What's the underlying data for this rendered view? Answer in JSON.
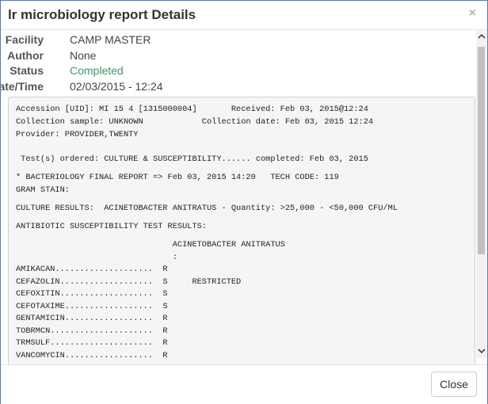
{
  "dialog": {
    "title": "lr microbiology report Details",
    "close_glyph": "×",
    "close_button_label": "Close"
  },
  "meta": {
    "facility_label": "Facility",
    "facility_value": "CAMP MASTER",
    "author_label": "Author",
    "author_value": "None",
    "status_label": "Status",
    "status_value": "Completed",
    "datetime_label": "Date/Time",
    "datetime_value": "02/03/2015 - 12:24"
  },
  "report": {
    "lines": [
      "Accession [UID]: MI 15 4 [1315000004]       Received: Feb 03, 2015@12:24",
      "Collection sample: UNKNOWN            Collection date: Feb 03, 2015 12:24",
      "Provider: PROVIDER,TWENTY",
      " Test(s) ordered: CULTURE & SUSCEPTIBILITY...... completed: Feb 03, 2015",
      "* BACTERIOLOGY FINAL REPORT => Feb 03, 2015 14:20   TECH CODE: 119",
      "GRAM STAIN:",
      "CULTURE RESULTS:  ACINETOBACTER ANITRATUS - Quantity: >25,000 - <50,000 CFU/ML",
      "ANTIBIOTIC SUSCEPTIBILITY TEST RESULTS:",
      "                                ACINETOBACTER ANITRATUS",
      "                                :",
      "AMIKACAN....................  R",
      "CEFAZOLIN...................  S     RESTRICTED",
      "CEFOXITIN...................  S",
      "CEFOTAXIME..................  S",
      "GENTAMICIN..................  R",
      "TOBRMCN.....................  R",
      "TRMSULF.....................  R",
      "VANCOMYCIN..................  R"
    ]
  },
  "icons": {
    "scroll_up": "chevron-up-icon",
    "scroll_down": "chevron-down-icon"
  }
}
